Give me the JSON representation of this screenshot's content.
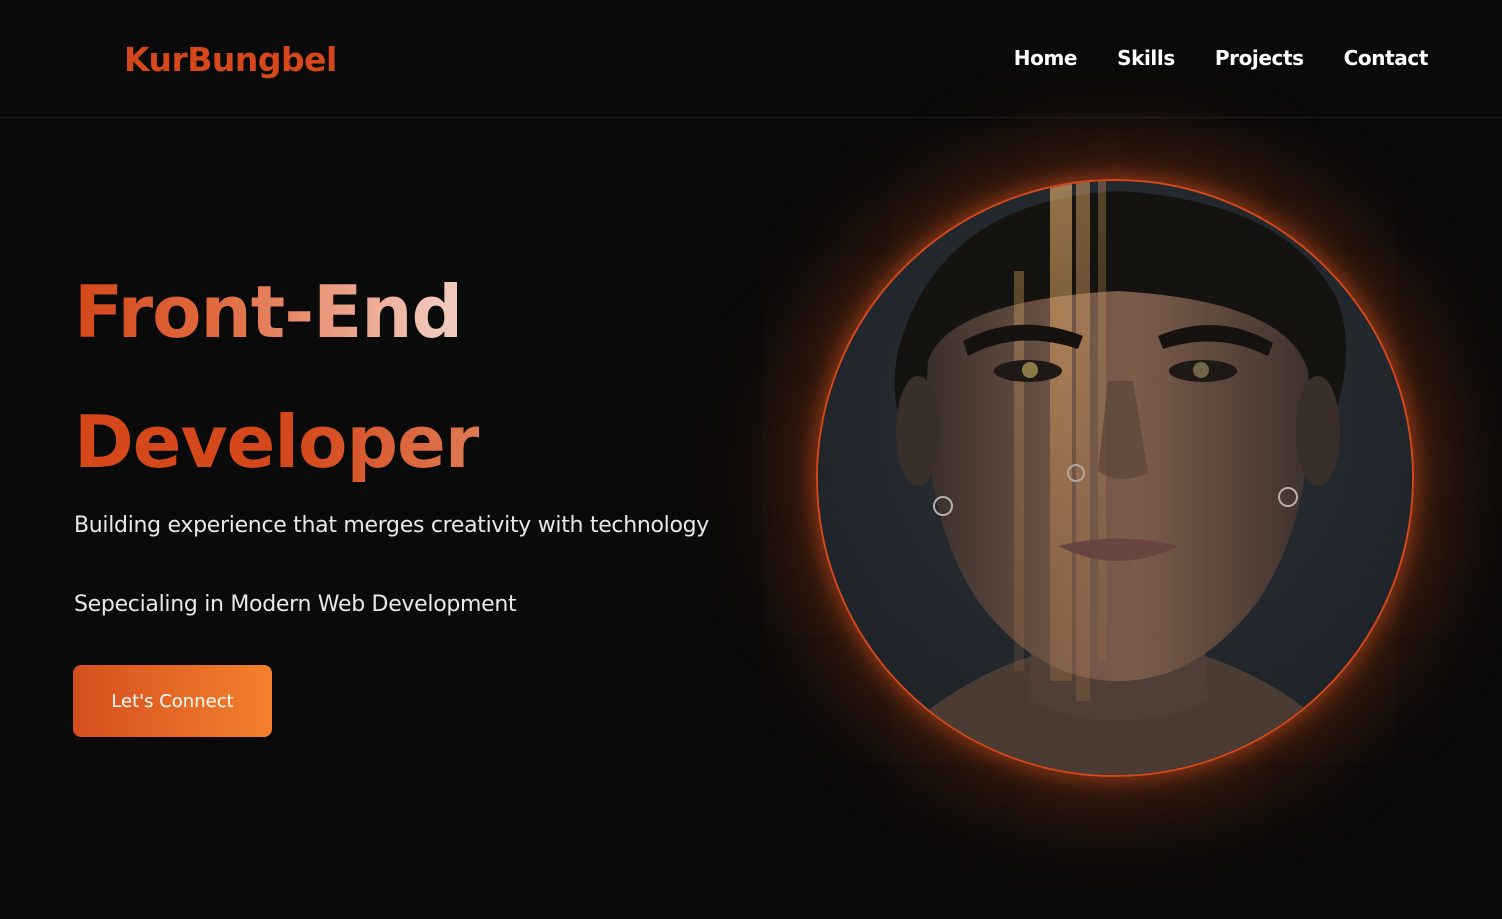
{
  "header": {
    "logo": "KurBungbel",
    "nav": [
      {
        "label": "Home"
      },
      {
        "label": "Skills"
      },
      {
        "label": "Projects"
      },
      {
        "label": "Contact"
      }
    ]
  },
  "hero": {
    "headline_line1": "Front-End",
    "headline_line2": "Developer",
    "subtitle_1": "Building experience that merges creativity with technology",
    "subtitle_2": "Sepecialing in Modern Web Development",
    "cta_label": "Let's Connect",
    "portrait_image": "portrait-photo"
  },
  "colors": {
    "background": "#0b0a0a",
    "accent": "#d4481b",
    "accent_light": "#f3812c",
    "text": "#ffffff"
  }
}
